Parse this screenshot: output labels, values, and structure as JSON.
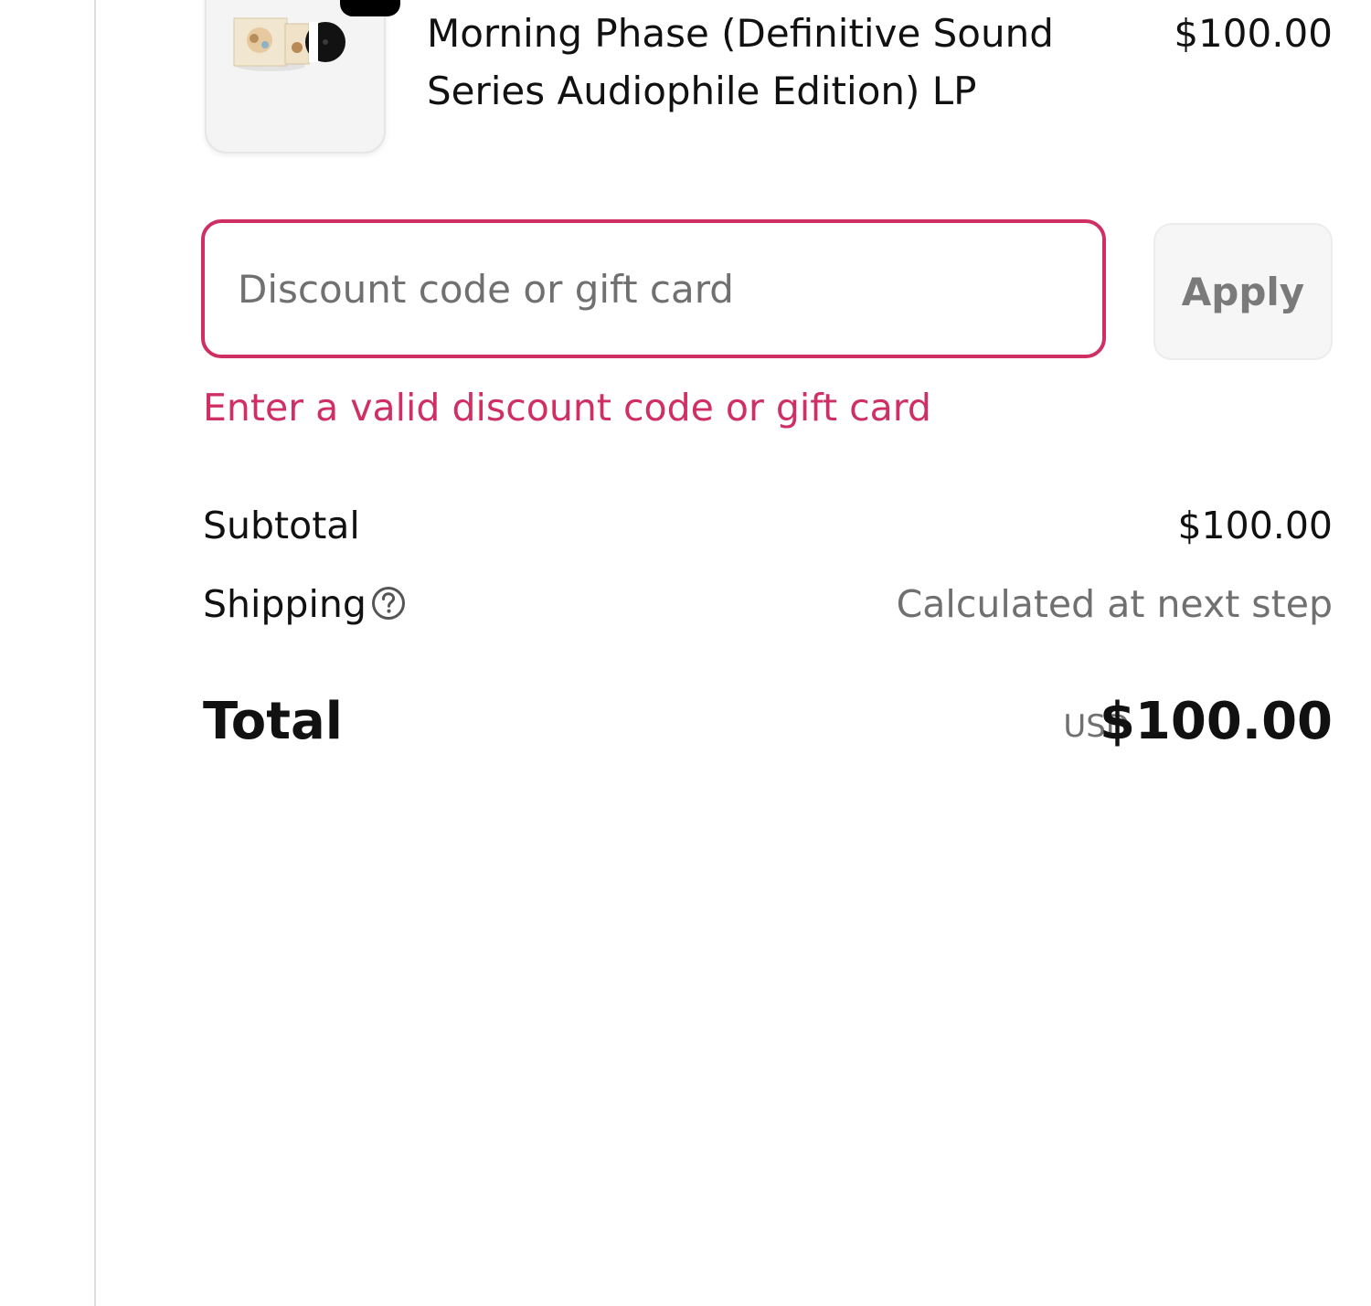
{
  "order_summary": {
    "product": {
      "name": "Morning Phase (Definitive Sound Series Audiophile Edition) LP",
      "price": "$100.00",
      "image_icon": "vinyl-album-thumbnail"
    },
    "discount": {
      "placeholder": "Discount code or gift card",
      "value": "",
      "apply_label": "Apply",
      "error": "Enter a valid discount code or gift card",
      "error_color": "#cf2f63"
    },
    "subtotal": {
      "label": "Subtotal",
      "value": "$100.00"
    },
    "shipping": {
      "label": "Shipping",
      "value": "Calculated at next step",
      "help_icon": "question-circle-icon"
    },
    "total": {
      "label": "Total",
      "currency": "USD",
      "value": "$100.00"
    }
  }
}
